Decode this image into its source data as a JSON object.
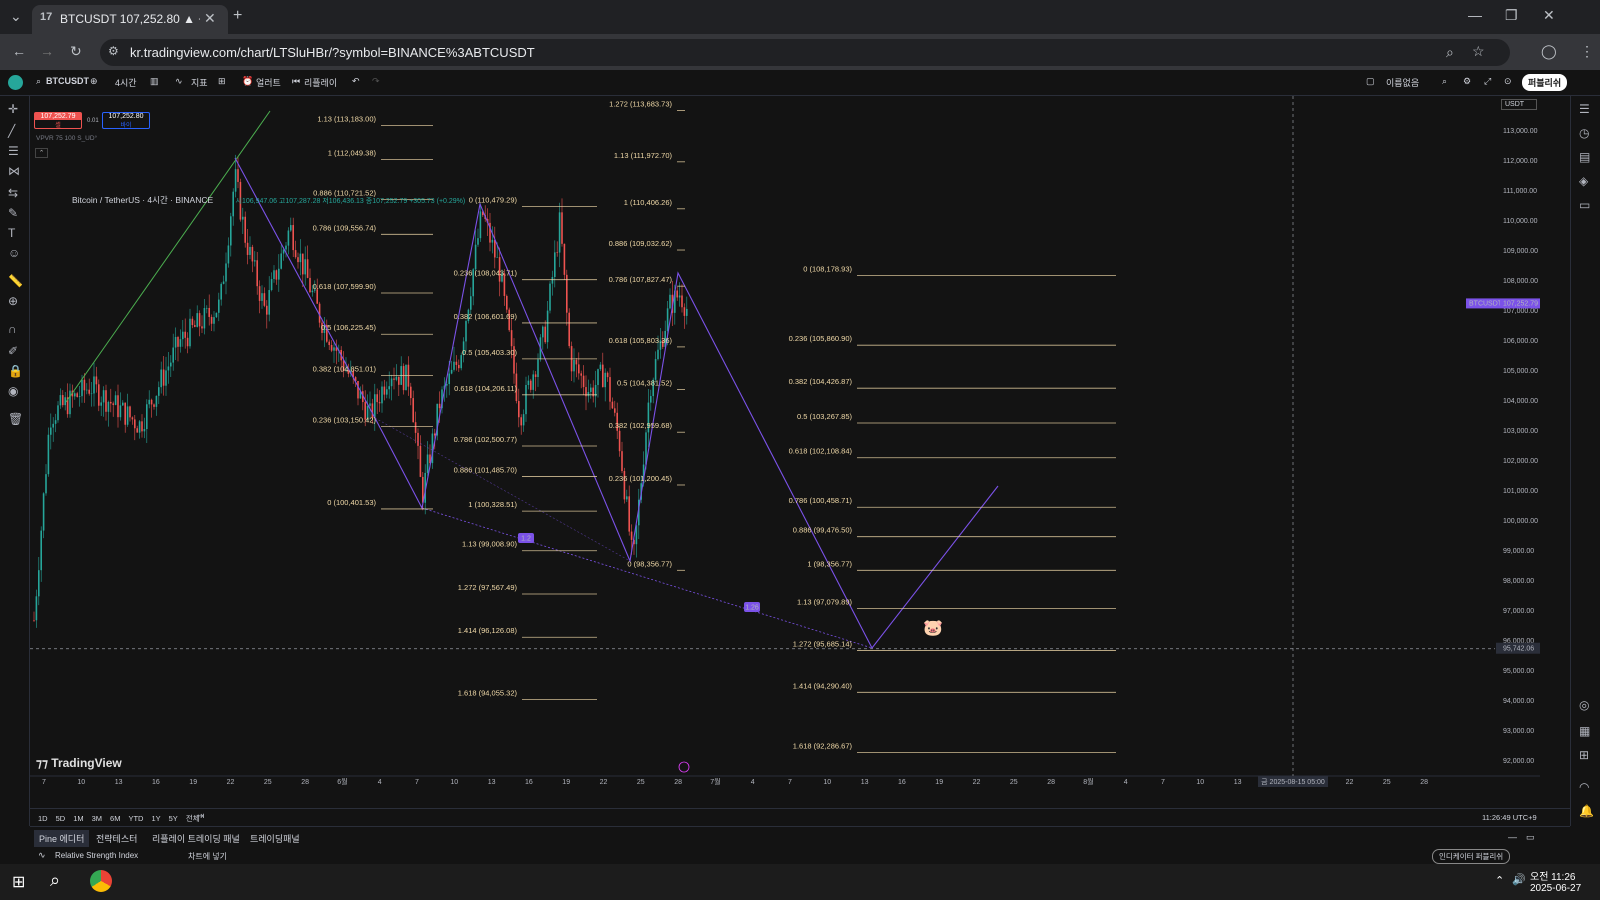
{
  "browser": {
    "tab_title": "BTCUSDT 107,252.80 ▲ +0.29",
    "url": "kr.tradingview.com/chart/LTSluHBr/?symbol=BINANCE%3ABTCUSDT"
  },
  "toolbar": {
    "symbol": "BTCUSDT",
    "interval": "4시간",
    "indicators": "지표",
    "alert": "얼러트",
    "replay": "리플레이",
    "unnamed": "이름없음",
    "publish": "퍼블리쉬"
  },
  "legend": {
    "symbol_line": "Bitcoin / TetherUS · 4시간 · BINANCE",
    "ohlc": "시106,947.06 고107,287.28 저106,436.13 종107,252.79 +305.73 (+0.29%)",
    "sell_price": "107,252.79",
    "sell_label": "셀",
    "spread": "0.01",
    "buy_price": "107,252.80",
    "buy_label": "바이",
    "vpvr": "VPVR 75 100 S_UD°"
  },
  "currency": "USDT",
  "price_axis": [
    "113,000.00",
    "112,000.00",
    "111,000.00",
    "110,000.00",
    "109,000.00",
    "108,000.00",
    "107,000.00",
    "106,000.00",
    "105,000.00",
    "104,000.00",
    "103,000.00",
    "102,000.00",
    "101,000.00",
    "100,000.00",
    "99,000.00",
    "98,000.00",
    "97,000.00",
    "96,000.00",
    "95,000.00",
    "94,000.00",
    "93,000.00",
    "92,000.00"
  ],
  "last_price_label": {
    "symbol": "BTCUSDT",
    "price": "107,252.79"
  },
  "crosshair_price": "95,742.06",
  "crosshair_date": "금 2025-08-15  05:00",
  "time_axis": [
    "7",
    "10",
    "13",
    "16",
    "19",
    "22",
    "25",
    "28",
    "6월",
    "4",
    "7",
    "10",
    "13",
    "16",
    "19",
    "22",
    "25",
    "28",
    "7월",
    "4",
    "7",
    "10",
    "13",
    "16",
    "19",
    "22",
    "25",
    "28",
    "8월",
    "4",
    "7",
    "10",
    "13",
    "16",
    "19",
    "22",
    "25",
    "28"
  ],
  "fib_sets": [
    {
      "levels": [
        "1.13 (113,183.00)",
        "1 (112,049.38)",
        "0.886 (110,721.52)",
        "0.786 (109,556.74)",
        "0.618 (107,599.90)",
        "0.5 (106,225.45)",
        "0.382 (104,851.01)",
        "0.236 (103,150.42)",
        "0 (100,401.53)"
      ]
    },
    {
      "levels": [
        "0 (110,479.29)",
        "0.236 (108,043.71)",
        "0.382 (106,601.69)",
        "0.5 (105,403.30)",
        "0.618 (104,206.11)",
        "0.786 (102,500.77)",
        "0.886 (101,485.70)",
        "1 (100,328.51)",
        "1.13 (99,008.90)",
        "1.272 (97,567.49)",
        "1.414 (96,126.08)",
        "1.618 (94,055.32)"
      ]
    },
    {
      "levels": [
        "1.272 (113,683.73)",
        "1.13 (111,972.70)",
        "1 (110,406.26)",
        "0.886 (109,032.62)",
        "0.786 (107,827.47)",
        "0.618 (105,803.36)",
        "0.5 (104,381.52)",
        "0.382 (102,959.68)",
        "0.236 (101,200.45)",
        "0 (98,356.77)"
      ]
    },
    {
      "levels": [
        "0 (108,178.93)",
        "0.236 (105,860.90)",
        "0.382 (104,426.87)",
        "0.5 (103,267.85)",
        "0.618 (102,108.84)",
        "0.786 (100,458.71)",
        "0.886 (99,476.50)",
        "1 (98,356.77)",
        "1.13 (97,079.89)",
        "1.272 (95,685.14)",
        "1.414 (94,290.40)",
        "1.618 (92,286.67)"
      ]
    }
  ],
  "ratio_badges": [
    "1.2",
    "1.26"
  ],
  "watermark": "TradingView",
  "ranges": [
    "1D",
    "5D",
    "1M",
    "3M",
    "6M",
    "YTD",
    "1Y",
    "5Y",
    "전체"
  ],
  "clock": "11:26:49 UTC+9",
  "panel_tabs": [
    "Pine 에디터",
    "전략테스터",
    "리플레이 트레이딩 패널",
    "트레이딩패널"
  ],
  "pine": {
    "script": "Relative Strength Index",
    "add": "차트에 넣기",
    "publish": "인디케이터 퍼블리쉬"
  },
  "taskbar": {
    "time": "오전 11:26",
    "date": "2025-06-27"
  },
  "colors": {
    "accent": "#2962ff",
    "fib": "#f0d9a8",
    "pattern": "#7b52e8",
    "up": "#26a69a",
    "down": "#ef5350"
  }
}
